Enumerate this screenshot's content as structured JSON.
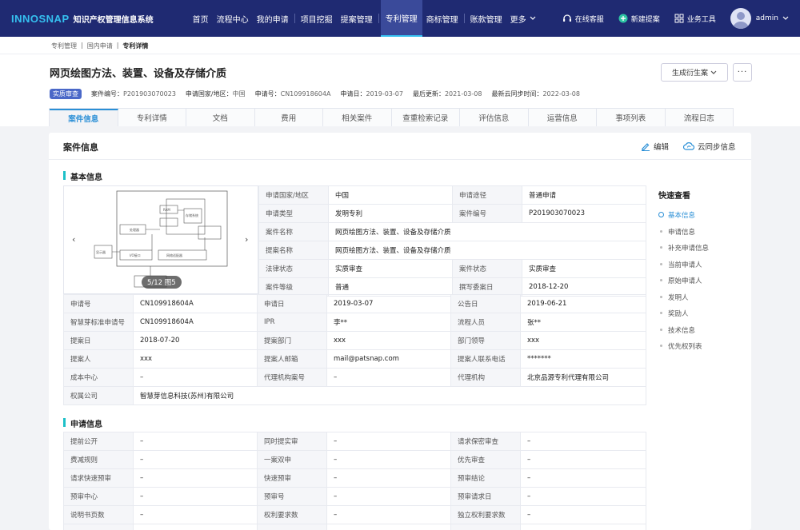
{
  "topbar": {
    "logo": "INNOSNAP",
    "system_name": "知识产权管理信息系统",
    "nav": [
      "首页",
      "流程中心",
      "我的申请",
      "项目挖掘",
      "提案管理",
      "专利管理",
      "商标管理",
      "账款管理",
      "更多"
    ],
    "active_nav": "专利管理",
    "online_service": "在线客服",
    "new_proposal": "新建提案",
    "business_tools": "业务工具",
    "username": "admin"
  },
  "breadcrumb": [
    "专利管理",
    "国内申请",
    "专利详情"
  ],
  "page": {
    "title": "网页绘图方法、装置、设备及存储介质",
    "generate_btn": "生成衍生案",
    "more_btn": "···",
    "status_badge": "实质审查",
    "meta": [
      {
        "label": "案件编号：",
        "value": "P201903070023"
      },
      {
        "label": "申请国家/地区：",
        "value": "中国"
      },
      {
        "label": "申请号：",
        "value": "CN109918604A"
      },
      {
        "label": "申请日：",
        "value": "2019-03-07"
      },
      {
        "label": "最后更新：",
        "value": "2021-03-08"
      },
      {
        "label": "最新云同步时间：",
        "value": "2022-03-08"
      }
    ]
  },
  "tabs": [
    "案件信息",
    "专利详情",
    "文档",
    "费用",
    "相关案件",
    "查重检索记录",
    "评估信息",
    "运营信息",
    "事项列表",
    "流程日志"
  ],
  "active_tab": "案件信息",
  "card": {
    "title": "案件信息",
    "edit": "编辑",
    "sync": "云同步信息"
  },
  "basic_info": {
    "title": "基本信息",
    "carousel_counter": "5/12 图5",
    "top_rows": [
      [
        "申请国家/地区",
        "中国",
        "申请途径",
        "普通申请"
      ],
      [
        "申请类型",
        "发明专利",
        "案件编号",
        "P201903070023"
      ],
      [
        "案件名称",
        "网页绘图方法、装置、设备及存储介质",
        "",
        ""
      ],
      [
        "提案名称",
        "网页绘图方法、装置、设备及存储介质",
        "",
        ""
      ],
      [
        "法律状态",
        "实质审查",
        "案件状态",
        "实质审查"
      ],
      [
        "案件等级",
        "普通",
        "撰写委案日",
        "2018-12-20"
      ]
    ],
    "full_rows": [
      [
        "申请号",
        "CN109918604A",
        "申请日",
        "2019-03-07",
        "公告日",
        "2019-06-21"
      ],
      [
        "智慧芽标准申请号",
        "CN109918604A",
        "IPR",
        "李**",
        "流程人员",
        "张**"
      ],
      [
        "提案日",
        "2018-07-20",
        "提案部门",
        "xxx",
        "部门领导",
        "xxx"
      ],
      [
        "提案人",
        "xxx",
        "提案人邮箱",
        "mail@patsnap.com",
        "提案人联系电话",
        "*******"
      ],
      [
        "成本中心",
        "–",
        "代理机构案号",
        "–",
        "代理机构",
        "北京品源专利代理有限公司"
      ],
      [
        "权属公司",
        "智慧芽信息科技(苏州)有限公司",
        "",
        "",
        "",
        ""
      ]
    ]
  },
  "application_info": {
    "title": "申请信息",
    "rows": [
      [
        "提前公开",
        "–",
        "同时提实审",
        "–",
        "请求保密审查",
        "–"
      ],
      [
        "费减规则",
        "–",
        "一案双申",
        "–",
        "优先审查",
        "–"
      ],
      [
        "请求快速预审",
        "–",
        "快速预审",
        "–",
        "预审结论",
        "–"
      ],
      [
        "预审中心",
        "–",
        "预审号",
        "–",
        "预审请求日",
        "–"
      ],
      [
        "说明书页数",
        "–",
        "权利要求数",
        "–",
        "独立权利要求数",
        "–"
      ],
      [
        "",
        "",
        "",
        "",
        "",
        ""
      ]
    ]
  },
  "quick_view": {
    "title": "快速查看",
    "items": [
      "基本信息",
      "申请信息",
      "补充申请信息",
      "当前申请人",
      "原始申请人",
      "发明人",
      "奖励人",
      "技术信息",
      "优先权列表"
    ],
    "active": "基本信息"
  },
  "colors": {
    "topbar": "#1f2a72",
    "accent": "#2a8fd6",
    "section_marker": "#1ec0c8",
    "badge": "#4a68c8"
  }
}
